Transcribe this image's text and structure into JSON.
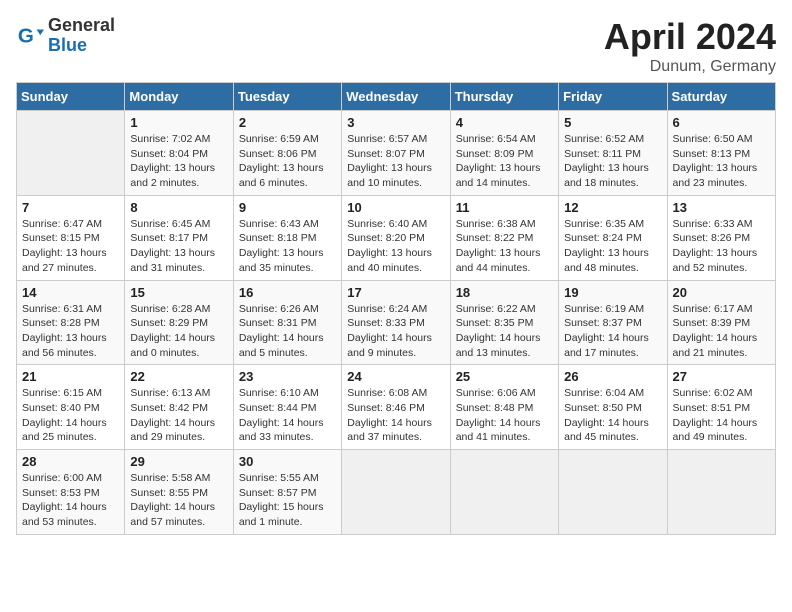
{
  "header": {
    "logo_general": "General",
    "logo_blue": "Blue",
    "title": "April 2024",
    "location": "Dunum, Germany"
  },
  "days_of_week": [
    "Sunday",
    "Monday",
    "Tuesday",
    "Wednesday",
    "Thursday",
    "Friday",
    "Saturday"
  ],
  "weeks": [
    [
      {
        "day": "",
        "sunrise": "",
        "sunset": "",
        "daylight": ""
      },
      {
        "day": "1",
        "sunrise": "Sunrise: 7:02 AM",
        "sunset": "Sunset: 8:04 PM",
        "daylight": "Daylight: 13 hours and 2 minutes."
      },
      {
        "day": "2",
        "sunrise": "Sunrise: 6:59 AM",
        "sunset": "Sunset: 8:06 PM",
        "daylight": "Daylight: 13 hours and 6 minutes."
      },
      {
        "day": "3",
        "sunrise": "Sunrise: 6:57 AM",
        "sunset": "Sunset: 8:07 PM",
        "daylight": "Daylight: 13 hours and 10 minutes."
      },
      {
        "day": "4",
        "sunrise": "Sunrise: 6:54 AM",
        "sunset": "Sunset: 8:09 PM",
        "daylight": "Daylight: 13 hours and 14 minutes."
      },
      {
        "day": "5",
        "sunrise": "Sunrise: 6:52 AM",
        "sunset": "Sunset: 8:11 PM",
        "daylight": "Daylight: 13 hours and 18 minutes."
      },
      {
        "day": "6",
        "sunrise": "Sunrise: 6:50 AM",
        "sunset": "Sunset: 8:13 PM",
        "daylight": "Daylight: 13 hours and 23 minutes."
      }
    ],
    [
      {
        "day": "7",
        "sunrise": "Sunrise: 6:47 AM",
        "sunset": "Sunset: 8:15 PM",
        "daylight": "Daylight: 13 hours and 27 minutes."
      },
      {
        "day": "8",
        "sunrise": "Sunrise: 6:45 AM",
        "sunset": "Sunset: 8:17 PM",
        "daylight": "Daylight: 13 hours and 31 minutes."
      },
      {
        "day": "9",
        "sunrise": "Sunrise: 6:43 AM",
        "sunset": "Sunset: 8:18 PM",
        "daylight": "Daylight: 13 hours and 35 minutes."
      },
      {
        "day": "10",
        "sunrise": "Sunrise: 6:40 AM",
        "sunset": "Sunset: 8:20 PM",
        "daylight": "Daylight: 13 hours and 40 minutes."
      },
      {
        "day": "11",
        "sunrise": "Sunrise: 6:38 AM",
        "sunset": "Sunset: 8:22 PM",
        "daylight": "Daylight: 13 hours and 44 minutes."
      },
      {
        "day": "12",
        "sunrise": "Sunrise: 6:35 AM",
        "sunset": "Sunset: 8:24 PM",
        "daylight": "Daylight: 13 hours and 48 minutes."
      },
      {
        "day": "13",
        "sunrise": "Sunrise: 6:33 AM",
        "sunset": "Sunset: 8:26 PM",
        "daylight": "Daylight: 13 hours and 52 minutes."
      }
    ],
    [
      {
        "day": "14",
        "sunrise": "Sunrise: 6:31 AM",
        "sunset": "Sunset: 8:28 PM",
        "daylight": "Daylight: 13 hours and 56 minutes."
      },
      {
        "day": "15",
        "sunrise": "Sunrise: 6:28 AM",
        "sunset": "Sunset: 8:29 PM",
        "daylight": "Daylight: 14 hours and 0 minutes."
      },
      {
        "day": "16",
        "sunrise": "Sunrise: 6:26 AM",
        "sunset": "Sunset: 8:31 PM",
        "daylight": "Daylight: 14 hours and 5 minutes."
      },
      {
        "day": "17",
        "sunrise": "Sunrise: 6:24 AM",
        "sunset": "Sunset: 8:33 PM",
        "daylight": "Daylight: 14 hours and 9 minutes."
      },
      {
        "day": "18",
        "sunrise": "Sunrise: 6:22 AM",
        "sunset": "Sunset: 8:35 PM",
        "daylight": "Daylight: 14 hours and 13 minutes."
      },
      {
        "day": "19",
        "sunrise": "Sunrise: 6:19 AM",
        "sunset": "Sunset: 8:37 PM",
        "daylight": "Daylight: 14 hours and 17 minutes."
      },
      {
        "day": "20",
        "sunrise": "Sunrise: 6:17 AM",
        "sunset": "Sunset: 8:39 PM",
        "daylight": "Daylight: 14 hours and 21 minutes."
      }
    ],
    [
      {
        "day": "21",
        "sunrise": "Sunrise: 6:15 AM",
        "sunset": "Sunset: 8:40 PM",
        "daylight": "Daylight: 14 hours and 25 minutes."
      },
      {
        "day": "22",
        "sunrise": "Sunrise: 6:13 AM",
        "sunset": "Sunset: 8:42 PM",
        "daylight": "Daylight: 14 hours and 29 minutes."
      },
      {
        "day": "23",
        "sunrise": "Sunrise: 6:10 AM",
        "sunset": "Sunset: 8:44 PM",
        "daylight": "Daylight: 14 hours and 33 minutes."
      },
      {
        "day": "24",
        "sunrise": "Sunrise: 6:08 AM",
        "sunset": "Sunset: 8:46 PM",
        "daylight": "Daylight: 14 hours and 37 minutes."
      },
      {
        "day": "25",
        "sunrise": "Sunrise: 6:06 AM",
        "sunset": "Sunset: 8:48 PM",
        "daylight": "Daylight: 14 hours and 41 minutes."
      },
      {
        "day": "26",
        "sunrise": "Sunrise: 6:04 AM",
        "sunset": "Sunset: 8:50 PM",
        "daylight": "Daylight: 14 hours and 45 minutes."
      },
      {
        "day": "27",
        "sunrise": "Sunrise: 6:02 AM",
        "sunset": "Sunset: 8:51 PM",
        "daylight": "Daylight: 14 hours and 49 minutes."
      }
    ],
    [
      {
        "day": "28",
        "sunrise": "Sunrise: 6:00 AM",
        "sunset": "Sunset: 8:53 PM",
        "daylight": "Daylight: 14 hours and 53 minutes."
      },
      {
        "day": "29",
        "sunrise": "Sunrise: 5:58 AM",
        "sunset": "Sunset: 8:55 PM",
        "daylight": "Daylight: 14 hours and 57 minutes."
      },
      {
        "day": "30",
        "sunrise": "Sunrise: 5:55 AM",
        "sunset": "Sunset: 8:57 PM",
        "daylight": "Daylight: 15 hours and 1 minute."
      },
      {
        "day": "",
        "sunrise": "",
        "sunset": "",
        "daylight": ""
      },
      {
        "day": "",
        "sunrise": "",
        "sunset": "",
        "daylight": ""
      },
      {
        "day": "",
        "sunrise": "",
        "sunset": "",
        "daylight": ""
      },
      {
        "day": "",
        "sunrise": "",
        "sunset": "",
        "daylight": ""
      }
    ]
  ]
}
